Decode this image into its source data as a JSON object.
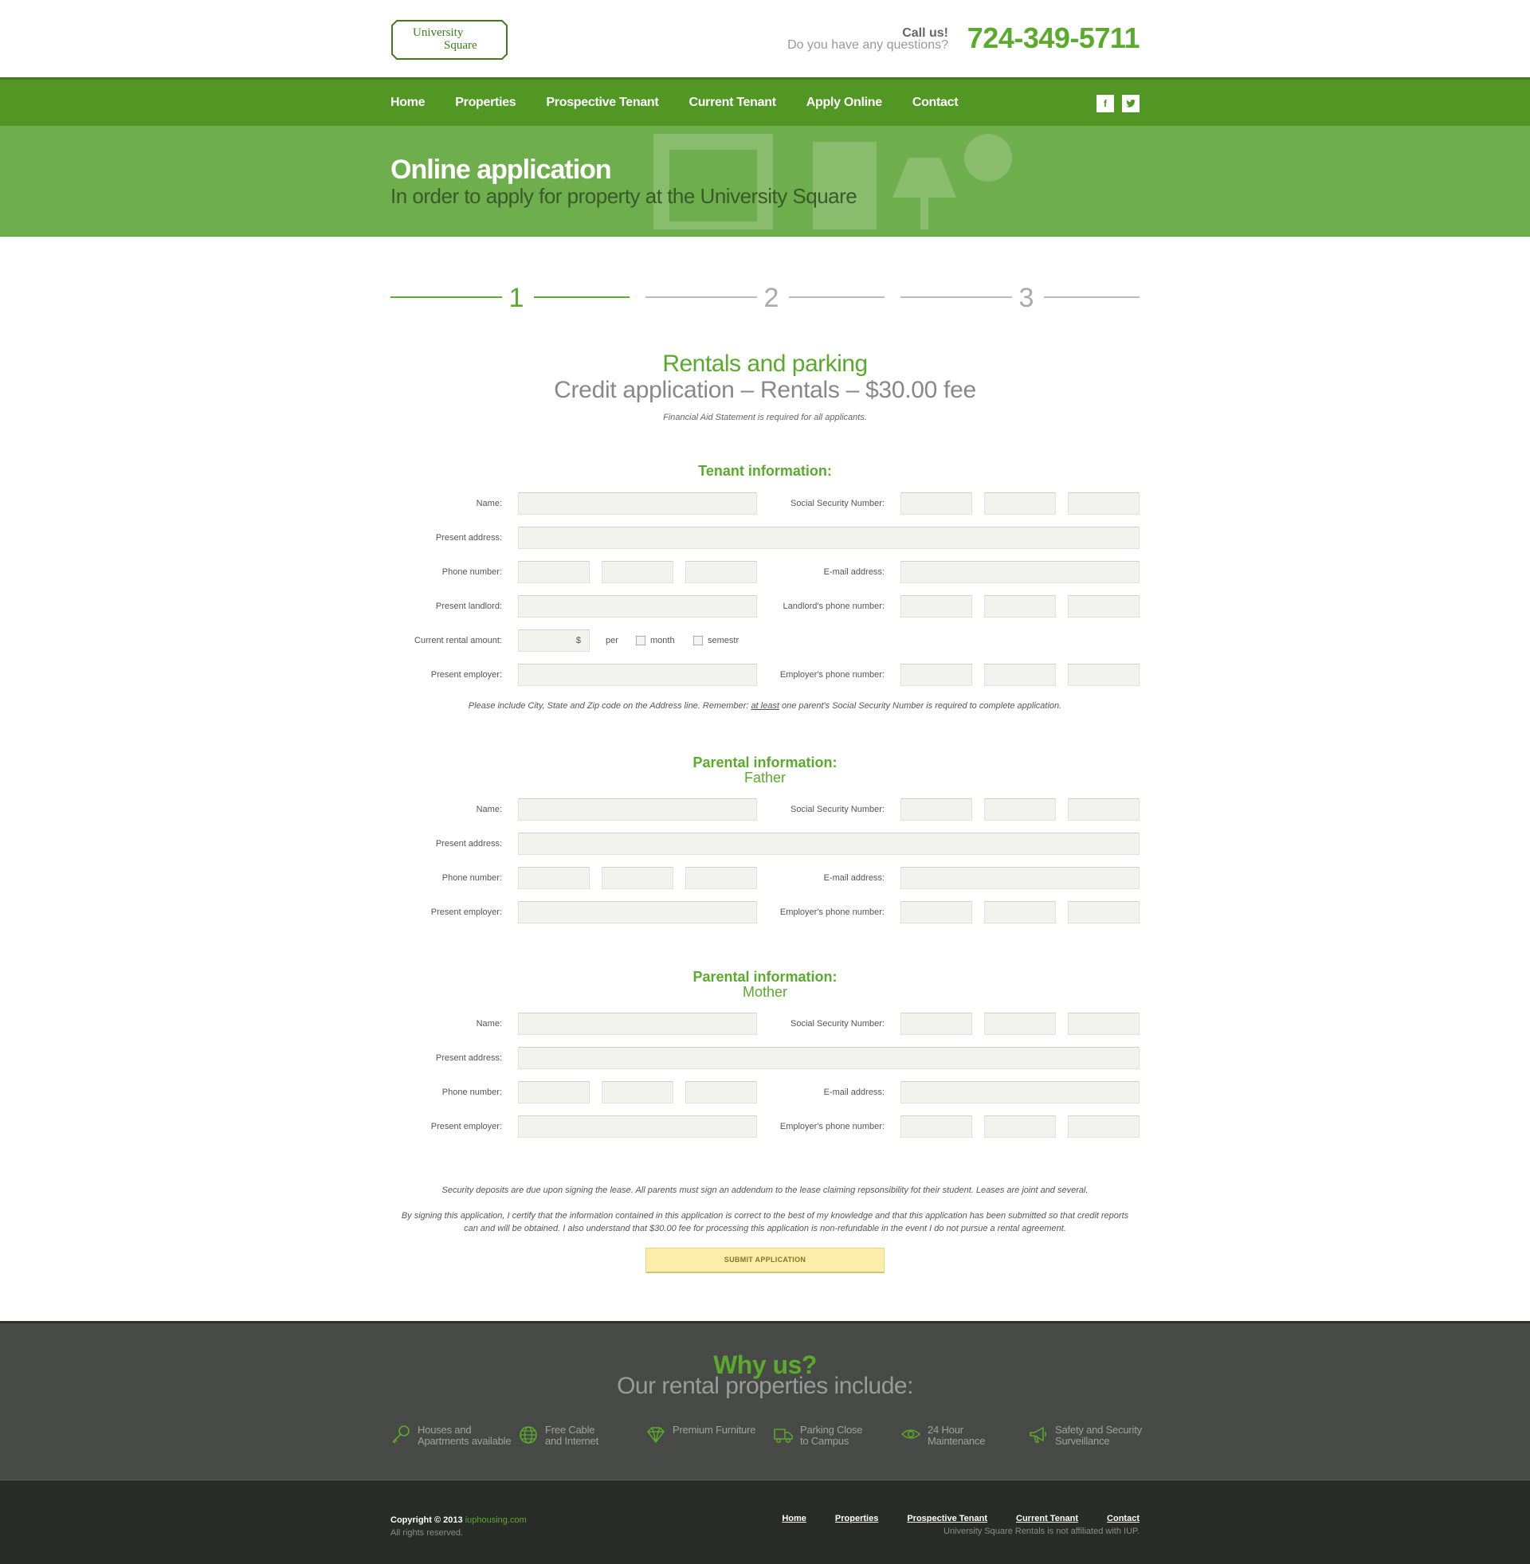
{
  "header": {
    "logo_line1": "University",
    "logo_line2": "Square",
    "call_title": "Call us!",
    "call_sub": "Do you have any questions?",
    "phone": "724-349-5711"
  },
  "nav": {
    "items": [
      "Home",
      "Properties",
      "Prospective Tenant",
      "Current Tenant",
      "Apply Online",
      "Contact"
    ],
    "social": [
      "f",
      "t"
    ]
  },
  "hero": {
    "title": "Online application",
    "subtitle": "In order to apply for property at the University Square"
  },
  "steps": [
    "1",
    "2",
    "3"
  ],
  "active_step": 1,
  "intro": {
    "title": "Rentals and parking",
    "subtitle": "Credit application  –  Rentals  –  $30.00 fee",
    "note": "Financial Aid Statement is required for all applicants."
  },
  "tenant": {
    "title": "Tenant information:",
    "name": "Name:",
    "ssn": "Social Security Number:",
    "address": "Present address:",
    "phone": "Phone number:",
    "email": "E-mail address:",
    "landlord": "Present landlord:",
    "landlord_phone": "Landlord's phone number:",
    "rental_amount": "Current rental amount:",
    "currency": "$",
    "per": "per",
    "month": "month",
    "semester": "semestr",
    "employer": "Present employer:",
    "employer_phone": "Employer's phone number:",
    "note_a": "Please include City, State and Zip code on the Address line. Remember: ",
    "note_b": "at least",
    "note_c": " one parent's Social Security Number is required to complete application."
  },
  "father": {
    "title": "Parental information:",
    "subtitle": "Father",
    "name": "Name:",
    "ssn": "Social Security Number:",
    "address": "Present address:",
    "phone": "Phone number:",
    "email": "E-mail address:",
    "employer": "Present employer:",
    "employer_phone": "Employer's phone number:"
  },
  "mother": {
    "title": "Parental information:",
    "subtitle": "Mother",
    "name": "Name:",
    "ssn": "Social Security Number:",
    "address": "Present address:",
    "phone": "Phone number:",
    "email": "E-mail address:",
    "employer": "Present employer:",
    "employer_phone": "Employer's phone number:"
  },
  "legal": {
    "p1": "Security deposits are due upon signing the lease. All parents must sign an addendum to the lease claiming repsonsibility fot their student. Leases are joint and several.",
    "p2": "By signing this application, I certify that the information contained in this application is correct to the best of my knowledge and that this application has been submitted so that credit reports can and will be obtained. I also understand that $30.00 fee for processing this application is non-refundable in the event I do not pursue a rental agreement.",
    "submit": "SUBMIT APPLICATION"
  },
  "why": {
    "title": "Why us?",
    "subtitle": "Our rental properties include:",
    "features": [
      {
        "icon": "key-icon",
        "l1": "Houses and",
        "l2": "Apartments available"
      },
      {
        "icon": "globe-icon",
        "l1": "Free Cable",
        "l2": "and Internet"
      },
      {
        "icon": "diamond-icon",
        "l1": "Premium Furniture",
        "l2": ""
      },
      {
        "icon": "truck-icon",
        "l1": "Parking Close",
        "l2": "to Campus"
      },
      {
        "icon": "eye-icon",
        "l1": "24 Hour",
        "l2": "Maintenance"
      },
      {
        "icon": "megaphone-icon",
        "l1": "Safety and Security",
        "l2": "Surveillance"
      }
    ]
  },
  "footer": {
    "copyright": "Copyright © 2013 ",
    "site": "iuphousing.com",
    "rights": "All rights reserved.",
    "links": [
      "Home",
      "Properties",
      "Prospective Tenant",
      "Current Tenant",
      "Contact"
    ],
    "disclaimer": "University Square Rentals is not affiliated with IUP."
  },
  "colors": {
    "brand_green": "#5aaa2c",
    "nav_green": "#529723",
    "hero_green": "#6fae4c",
    "submit_yellow": "#fcedaa",
    "why_bg": "#474a46",
    "footer_bg": "#2a2c29"
  }
}
